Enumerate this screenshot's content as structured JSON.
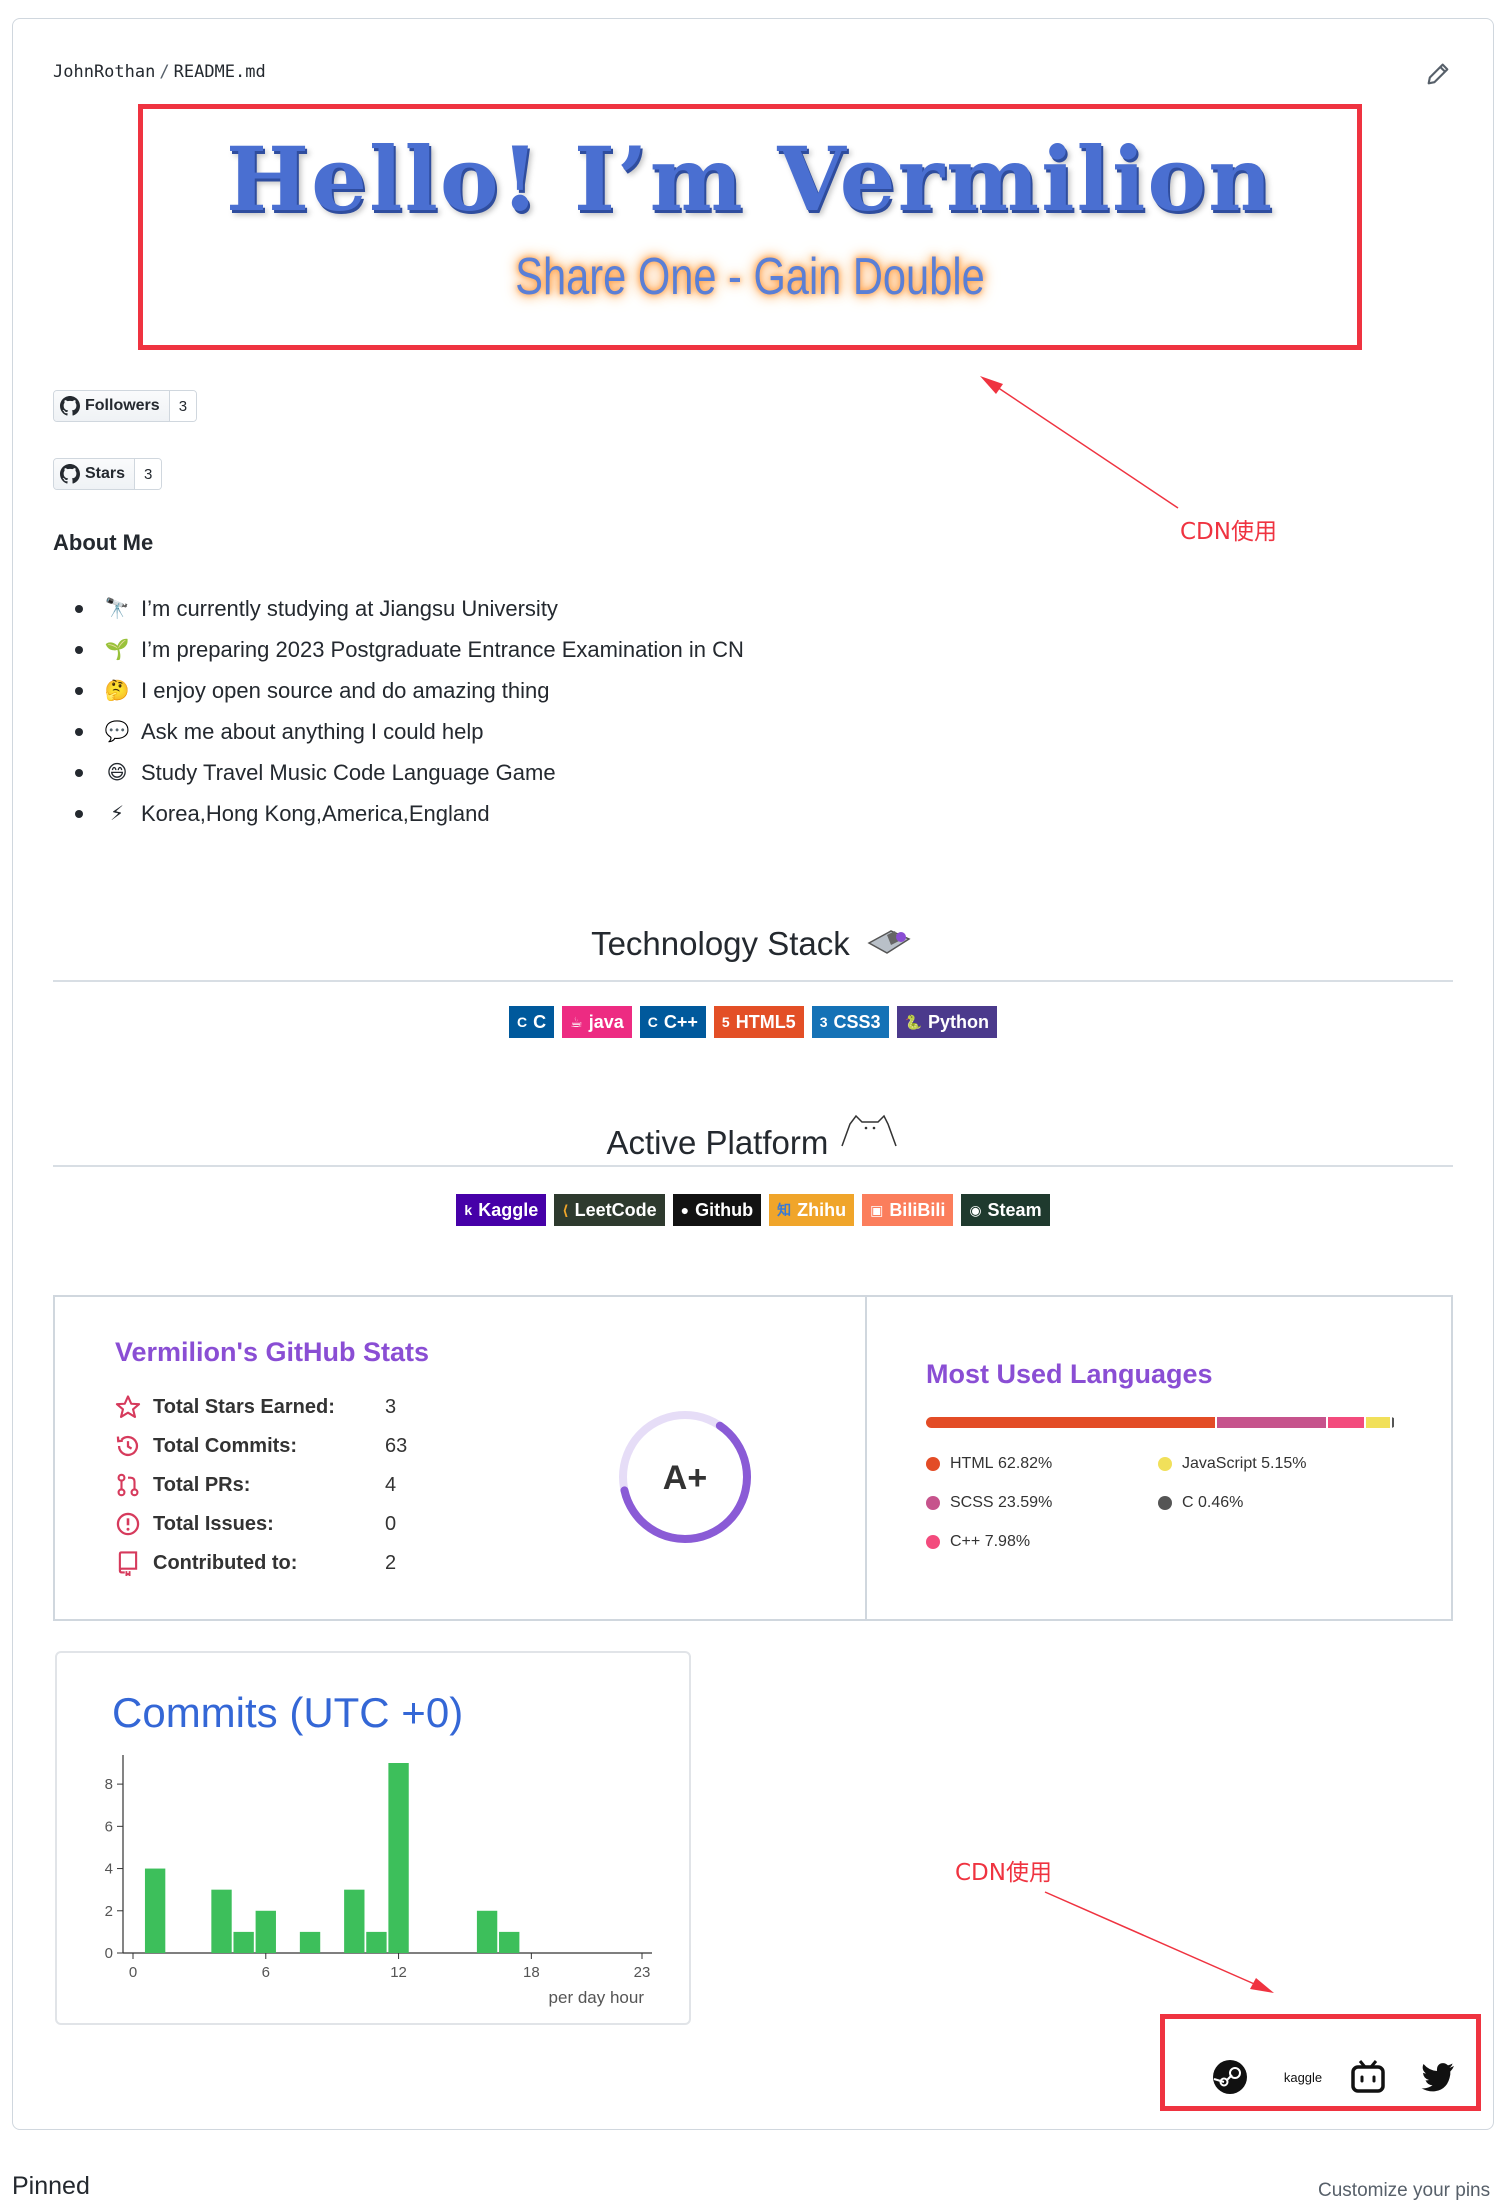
{
  "header": {
    "owner": "JohnRothan",
    "separator": "/",
    "file": "README.md",
    "edit_icon": "pencil-icon"
  },
  "hero": {
    "title": "Hello! I’m Vermilion",
    "subtitle": "Share One - Gain Double"
  },
  "badges": [
    {
      "label": "Followers",
      "count": "3",
      "icon": "github-icon"
    },
    {
      "label": "Stars",
      "count": "3",
      "icon": "github-icon"
    }
  ],
  "about": {
    "heading": "About Me",
    "items": [
      {
        "emoji": "🔭",
        "text": "I’m currently studying at Jiangsu University"
      },
      {
        "emoji": "🌱",
        "text": "I’m preparing 2023 Postgraduate Entrance Examination in CN"
      },
      {
        "emoji": "🤔",
        "text": "I enjoy open source and do amazing thing"
      },
      {
        "emoji": "💬",
        "text": "Ask me about anything I could help"
      },
      {
        "emoji": "😄",
        "text": "Study Travel Music Code Language Game"
      },
      {
        "emoji": "⚡",
        "text": "Korea,Hong Kong,America,England"
      }
    ]
  },
  "tech": {
    "heading": "Technology Stack",
    "items": [
      {
        "label": "C",
        "icon": "C",
        "color": "#00599c"
      },
      {
        "label": "java",
        "icon": "☕",
        "color": "#ed2b82"
      },
      {
        "label": "C++",
        "icon": "C",
        "color": "#00599c"
      },
      {
        "label": "HTML5",
        "icon": "5",
        "color": "#e34f26"
      },
      {
        "label": "CSS3",
        "icon": "3",
        "color": "#1572b6"
      },
      {
        "label": "Python",
        "icon": "🐍",
        "color": "#3776ab"
      }
    ]
  },
  "platform": {
    "heading": "Active Platform",
    "items": [
      {
        "label": "Kaggle",
        "icon": "k",
        "color": "#4600a8"
      },
      {
        "label": "LeetCode",
        "icon": "⟨",
        "color": "#2e3a2e"
      },
      {
        "label": "Github",
        "icon": "●",
        "color": "#121212"
      },
      {
        "label": "Zhihu",
        "icon": "知",
        "color": "#f0a52a"
      },
      {
        "label": "BiliBili",
        "icon": "▣",
        "color": "#fb7e5c"
      },
      {
        "label": "Steam",
        "icon": "◉",
        "color": "#1f3a2e"
      }
    ]
  },
  "stats": {
    "title": "Vermilion's GitHub Stats",
    "rank": "A+",
    "rows": [
      {
        "label": "Total Stars Earned:",
        "value": "3",
        "icon": "star-icon"
      },
      {
        "label": "Total Commits:",
        "value": "63",
        "icon": "history-icon"
      },
      {
        "label": "Total PRs:",
        "value": "4",
        "icon": "pull-request-icon"
      },
      {
        "label": "Total Issues:",
        "value": "0",
        "icon": "issue-icon"
      },
      {
        "label": "Contributed to:",
        "value": "2",
        "icon": "repo-icon"
      }
    ],
    "rank_progress": 0.62
  },
  "languages": {
    "title": "Most Used Languages",
    "items": [
      {
        "name": "HTML",
        "percent": "62.82%",
        "value": 62.82,
        "color": "#e34c26"
      },
      {
        "name": "SCSS",
        "percent": "23.59%",
        "value": 23.59,
        "color": "#c6538c"
      },
      {
        "name": "C++",
        "percent": "7.98%",
        "value": 7.98,
        "color": "#f34b7d"
      },
      {
        "name": "JavaScript",
        "percent": "5.15%",
        "value": 5.15,
        "color": "#f1e05a"
      },
      {
        "name": "C",
        "percent": "0.46%",
        "value": 0.46,
        "color": "#555555"
      }
    ]
  },
  "chart_data": {
    "type": "bar",
    "title": "Commits (UTC +0)",
    "xlabel": "per day hour",
    "ylabel": "",
    "x": [
      1,
      4,
      5,
      6,
      8,
      10,
      11,
      12,
      16,
      17
    ],
    "values": [
      4,
      3,
      1,
      2,
      1,
      3,
      1,
      9,
      2,
      1
    ],
    "xticks": [
      0,
      6,
      12,
      18,
      23
    ],
    "yticks": [
      0,
      2,
      4,
      6,
      8
    ],
    "xlim": [
      0,
      23
    ],
    "ylim": [
      0,
      9
    ],
    "color": "#3dbf5b",
    "grid": false
  },
  "annotations": {
    "top": "CDN使用",
    "bottom": "CDN使用"
  },
  "social": [
    {
      "name": "steam-icon",
      "label": ""
    },
    {
      "name": "kaggle-icon",
      "label": "kaggle"
    },
    {
      "name": "bilibili-icon",
      "label": ""
    },
    {
      "name": "twitter-icon",
      "label": ""
    }
  ],
  "footer": {
    "pinned": "Pinned",
    "customize": "Customize your pins"
  }
}
